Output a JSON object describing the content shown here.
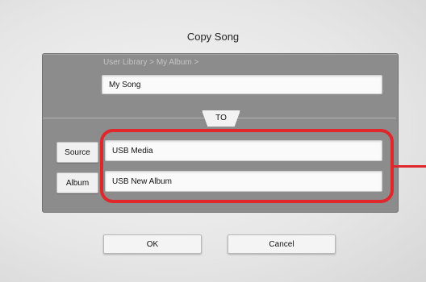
{
  "dialog": {
    "title": "Copy Song",
    "path": "User Library > My Album >",
    "song_name": "My Song",
    "to_label": "TO",
    "source_button": "Source",
    "source_value": "USB Media",
    "album_button": "Album",
    "album_value": "USB New Album",
    "ok_label": "OK",
    "cancel_label": "Cancel"
  },
  "colors": {
    "highlight": "#e0282c",
    "panel": "#8c8c8c"
  }
}
